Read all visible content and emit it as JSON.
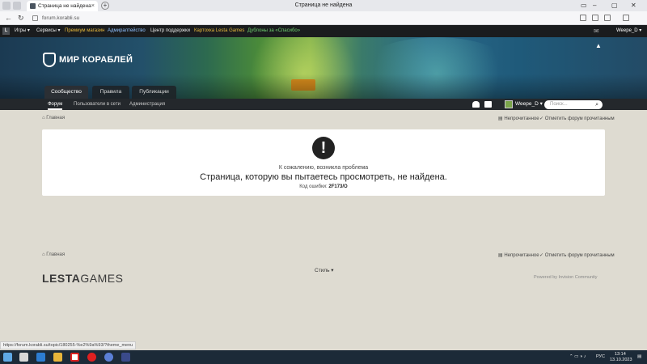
{
  "browser": {
    "tab_title": "Страница не найдена",
    "window_title": "Страница не найдена",
    "url": "forum.korabli.su",
    "status_url": "https://forum.korabli.su/topic/180255-%e2%9a%93/?theme_menu"
  },
  "topnav": {
    "items": [
      {
        "label": "Игры ▾",
        "color": "#e6e6e6"
      },
      {
        "label": "Сервисы ▾",
        "color": "#e6e6e6"
      },
      {
        "label": "Премиум магазин",
        "color": "#e7b93c"
      },
      {
        "label": "Адмиралтейство",
        "color": "#8fc0ff"
      },
      {
        "label": "Центр поддержки",
        "color": "#e6e6e6"
      },
      {
        "label": "Картохка Lesta Games",
        "color": "#e7b93c"
      },
      {
        "label": "Дублоны за «Спасибо»",
        "color": "#6fd06f"
      }
    ],
    "user": "Weepe_D ▾"
  },
  "site": {
    "logo": "МИР КОРАБЛЕЙ",
    "tabs": [
      "Сообщество",
      "Правила",
      "Публикации"
    ]
  },
  "subnav": {
    "items": [
      "Форум",
      "Пользователи в сети",
      "Администрация"
    ],
    "user": "Weepe_D ▾",
    "search_placeholder": "Поиск..."
  },
  "breadcrumb": {
    "home": "Главная",
    "unread": "Непрочитанное",
    "mark_read": "Отметить форум прочитанным"
  },
  "error": {
    "sorry": "К сожалению, возникла проблема",
    "message": "Страница, которую вы пытаетесь просмотреть, не найдена.",
    "code_label": "Код ошибки:",
    "code": "2F173/O"
  },
  "footer": {
    "home": "Главная",
    "unread": "Непрочитанное",
    "mark_read": "Отметить форум прочитанным",
    "style": "Стиль ▾",
    "brand_bold": "LESTA",
    "brand_light": "GAMES",
    "powered": "Powered by Invision Community"
  },
  "taskbar": {
    "lang": "РУС",
    "time": "13:14",
    "date": "13.10.2023"
  }
}
